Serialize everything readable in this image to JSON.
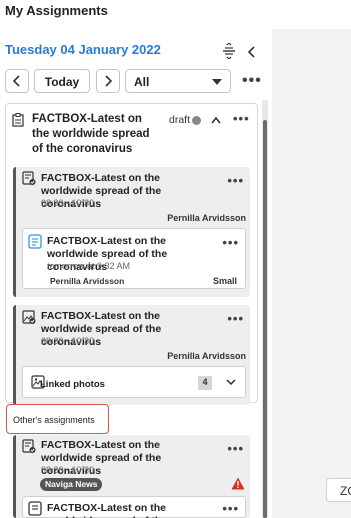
{
  "page": {
    "title": "My Assignments"
  },
  "header": {
    "date": "Tuesday 04 January 2022"
  },
  "toolbar": {
    "today_label": "Today",
    "filter_value": "All"
  },
  "plan": {
    "title": "FACTBOX-Latest on the worldwide spread of the coronavirus",
    "status": "draft",
    "status_color": "#888888"
  },
  "assignments": [
    {
      "title": "FACTBOX-Latest on the worldwide spread of the coronavirus",
      "time": "08:30 - 10:30",
      "assignee": "Pernilla Arvidsson",
      "deliverable": {
        "title": "FACTBOX-Latest on the worldwide spread of the coronavirus",
        "time": "tomorrow at 9:32 AM",
        "assignee": "Pernilla Arvidsson",
        "size": "Small"
      }
    },
    {
      "title": "FACTBOX-Latest on the worldwide spread of the coronavirus",
      "time": "08:30 - 10:30",
      "assignee": "Pernilla Arvidsson",
      "linked": {
        "label": "Linked photos",
        "count": "4"
      }
    }
  ],
  "others": {
    "label": "Other's assignments",
    "items": [
      {
        "title": "FACTBOX-Latest on the worldwide spread of the coronavirus",
        "time": "08:30 - 10:30",
        "badge": "Naviga News",
        "sub_title": "FACTBOX-Latest on the worldwide spread of the coronavirus"
      }
    ]
  },
  "right_panel": {
    "zoom_label": "ZO"
  },
  "colors": {
    "accent": "#2b7bd6",
    "warning": "#d93025",
    "highlight_border": "#d9534f"
  }
}
